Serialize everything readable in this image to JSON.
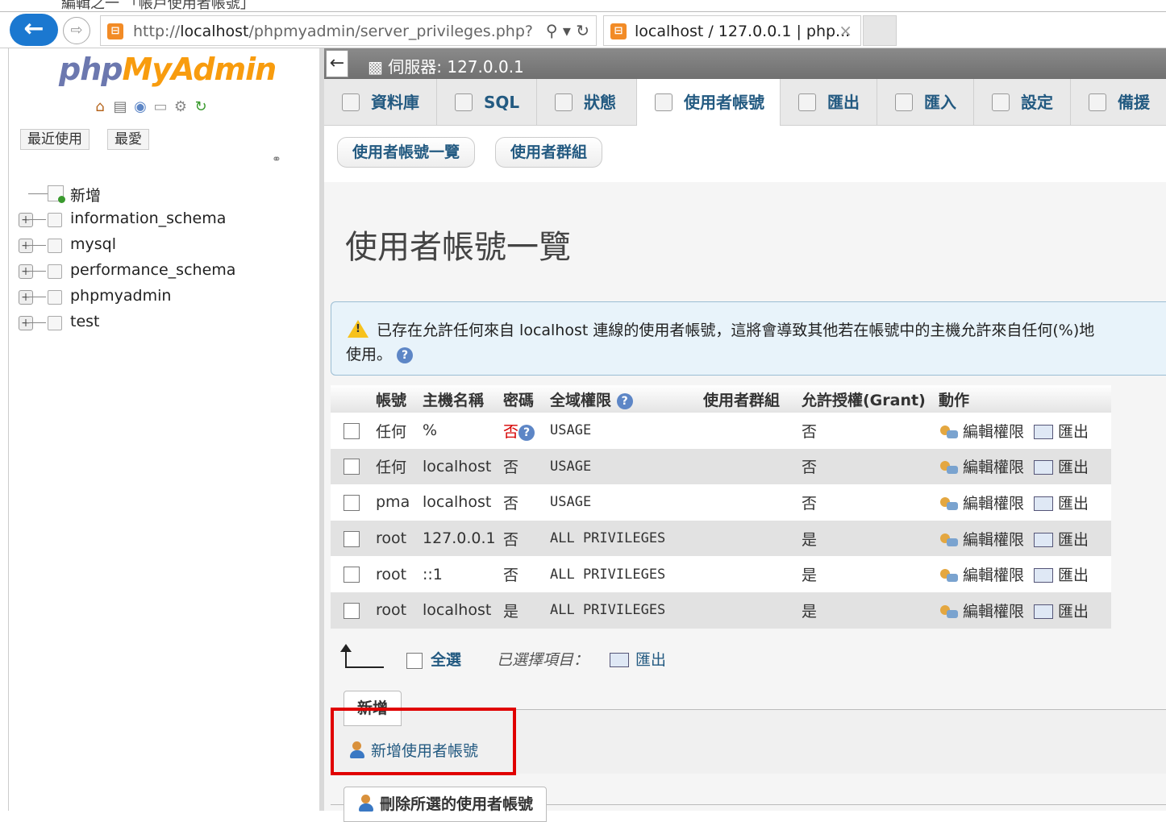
{
  "browser": {
    "topcut_text": "編輯之一 「帳戶使用者帳號」",
    "url_prefix": "http://",
    "url_host": "localhost",
    "url_path": "/phpmyadmin/server_privileges.php?",
    "tab_title": "localhost / 127.0.0.1 | php...",
    "favicon": "xampp-icon"
  },
  "sidebar": {
    "logo_php": "php",
    "logo_my": "My",
    "logo_admin": "Admin",
    "recent_label": "最近使用",
    "favorites_label": "最愛",
    "tree": [
      {
        "label": "新增",
        "type": "new"
      },
      {
        "label": "information_schema",
        "type": "db"
      },
      {
        "label": "mysql",
        "type": "db"
      },
      {
        "label": "performance_schema",
        "type": "db"
      },
      {
        "label": "phpmyadmin",
        "type": "db"
      },
      {
        "label": "test",
        "type": "db"
      }
    ]
  },
  "server": {
    "label": "伺服器: 127.0.0.1"
  },
  "topmenu": [
    {
      "label": "資料庫"
    },
    {
      "label": "SQL"
    },
    {
      "label": "狀態"
    },
    {
      "label": "使用者帳號",
      "active": true
    },
    {
      "label": "匯出"
    },
    {
      "label": "匯入"
    },
    {
      "label": "設定"
    },
    {
      "label": "備援"
    }
  ],
  "subtabs": {
    "user_list": "使用者帳號一覽",
    "user_groups": "使用者群組"
  },
  "page_title": "使用者帳號一覽",
  "notice": {
    "line1": "已存在允許任何來自 localhost 連線的使用者帳號，這將會導致其他若在帳號中的主機允許來自任何(%)地",
    "line2": "使用。"
  },
  "table": {
    "headers": {
      "account": "帳號",
      "host": "主機名稱",
      "password": "密碼",
      "global": "全域權限",
      "group": "使用者群組",
      "grant": "允許授權(Grant)",
      "action": "動作"
    },
    "rows": [
      {
        "user": "任何",
        "host": "%",
        "password": "否",
        "privileges": "USAGE",
        "group": "",
        "grant": "否"
      },
      {
        "user": "任何",
        "host": "localhost",
        "password": "否",
        "privileges": "USAGE",
        "group": "",
        "grant": "否"
      },
      {
        "user": "pma",
        "host": "localhost",
        "password": "否",
        "privileges": "USAGE",
        "group": "",
        "grant": "否"
      },
      {
        "user": "root",
        "host": "127.0.0.1",
        "password": "否",
        "privileges": "ALL PRIVILEGES",
        "group": "",
        "grant": "是"
      },
      {
        "user": "root",
        "host": "::1",
        "password": "否",
        "privileges": "ALL PRIVILEGES",
        "group": "",
        "grant": "是"
      },
      {
        "user": "root",
        "host": "localhost",
        "password": "是",
        "privileges": "ALL PRIVILEGES",
        "group": "",
        "grant": "是"
      }
    ],
    "edit_label": "編輯權限",
    "export_label": "匯出"
  },
  "with_selected": {
    "check_all": "全選",
    "label": "已選擇項目：",
    "export": "匯出"
  },
  "new_section": {
    "legend": "新增",
    "add_user": "新增使用者帳號"
  },
  "remove_section": {
    "legend": "刪除所選的使用者帳號"
  }
}
